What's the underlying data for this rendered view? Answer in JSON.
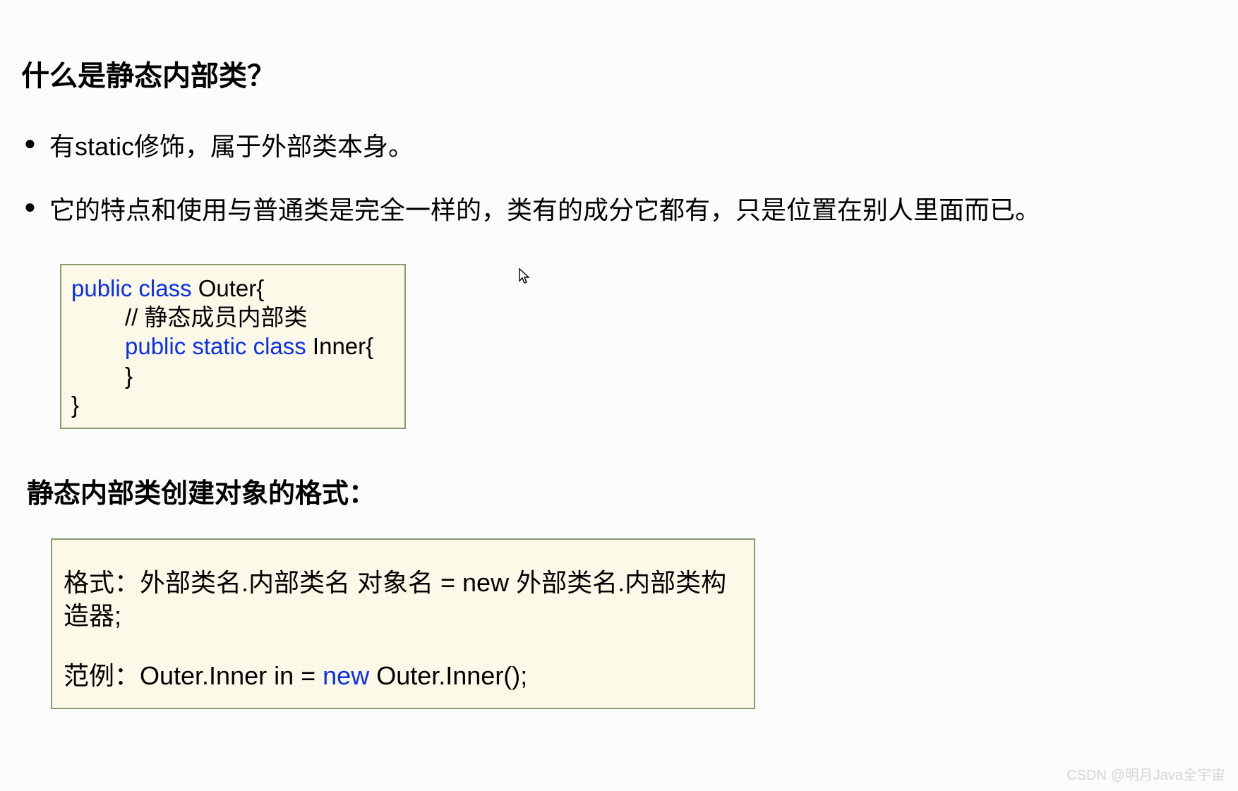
{
  "heading1": "什么是静态内部类？",
  "bullets": [
    "有static修饰，属于外部类本身。",
    "它的特点和使用与普通类是完全一样的，类有的成分它都有，只是位置在别人里面而已。"
  ],
  "code1": {
    "kw1": "public class",
    "line1_rest": " Outer{",
    "line2": "// 静态成员内部类",
    "kw2": "public static class",
    "line3_rest": " Inner{",
    "line4": "}",
    "line5": "}"
  },
  "heading2": "静态内部类创建对象的格式：",
  "code2": {
    "row1": "格式：外部类名.内部类名 对象名 = new 外部类名.内部类构造器;",
    "row2_pre": "范例：Outer.Inner in =  ",
    "row2_kw": "new",
    "row2_post": " Outer.Inner();"
  },
  "watermark": "CSDN @明月Java全宇宙"
}
